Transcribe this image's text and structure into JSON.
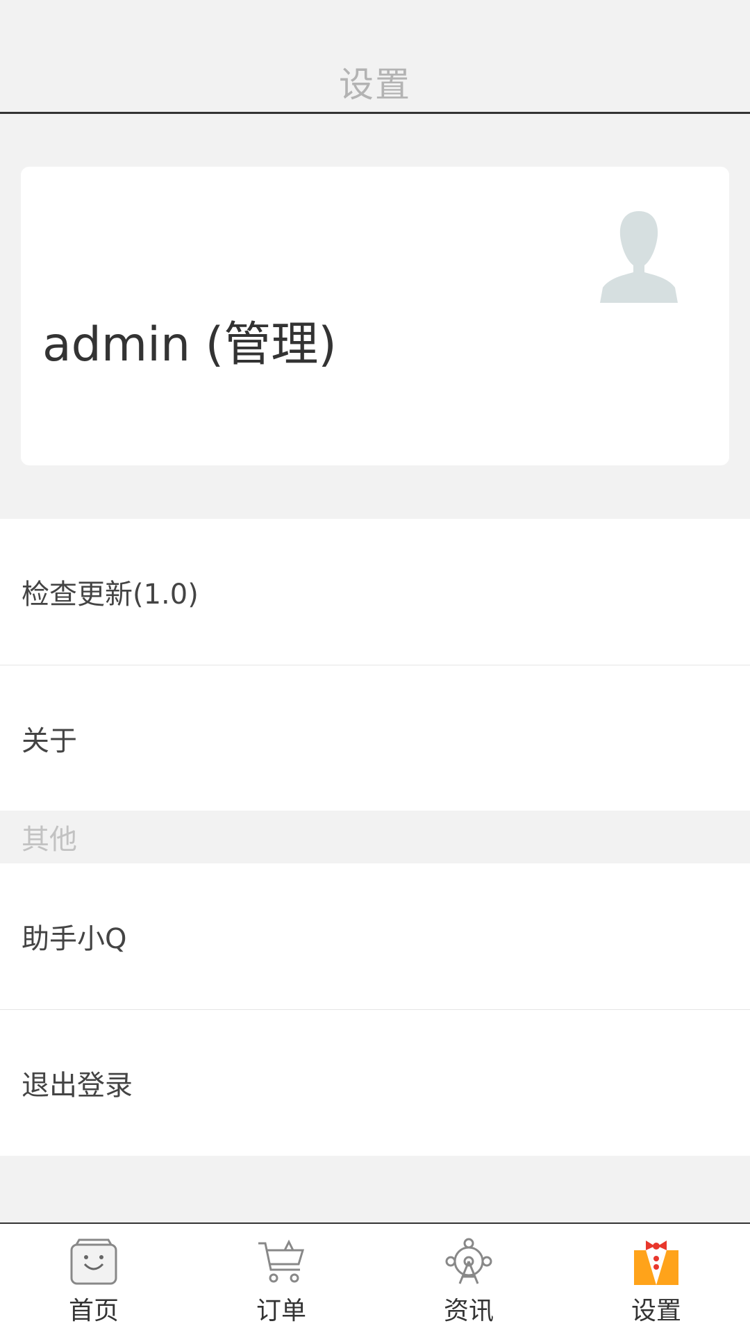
{
  "header": {
    "title": "设置"
  },
  "profile": {
    "username": "admin (管理)",
    "avatar_icon": "user-silhouette-icon",
    "avatar_color": "#d6dfe0"
  },
  "menu": {
    "check_update": "检查更新(1.0)",
    "about": "关于",
    "section_other": "其他",
    "assistant": "助手小Q",
    "logout": "退出登录"
  },
  "tabs": [
    {
      "label": "首页",
      "icon": "shopping-bag-icon"
    },
    {
      "label": "订单",
      "icon": "cart-icon"
    },
    {
      "label": "资讯",
      "icon": "ferris-wheel-icon"
    },
    {
      "label": "设置",
      "icon": "butler-icon",
      "active": true
    }
  ],
  "colors": {
    "accent": "#ffa31a",
    "bow": "#e8372c"
  }
}
